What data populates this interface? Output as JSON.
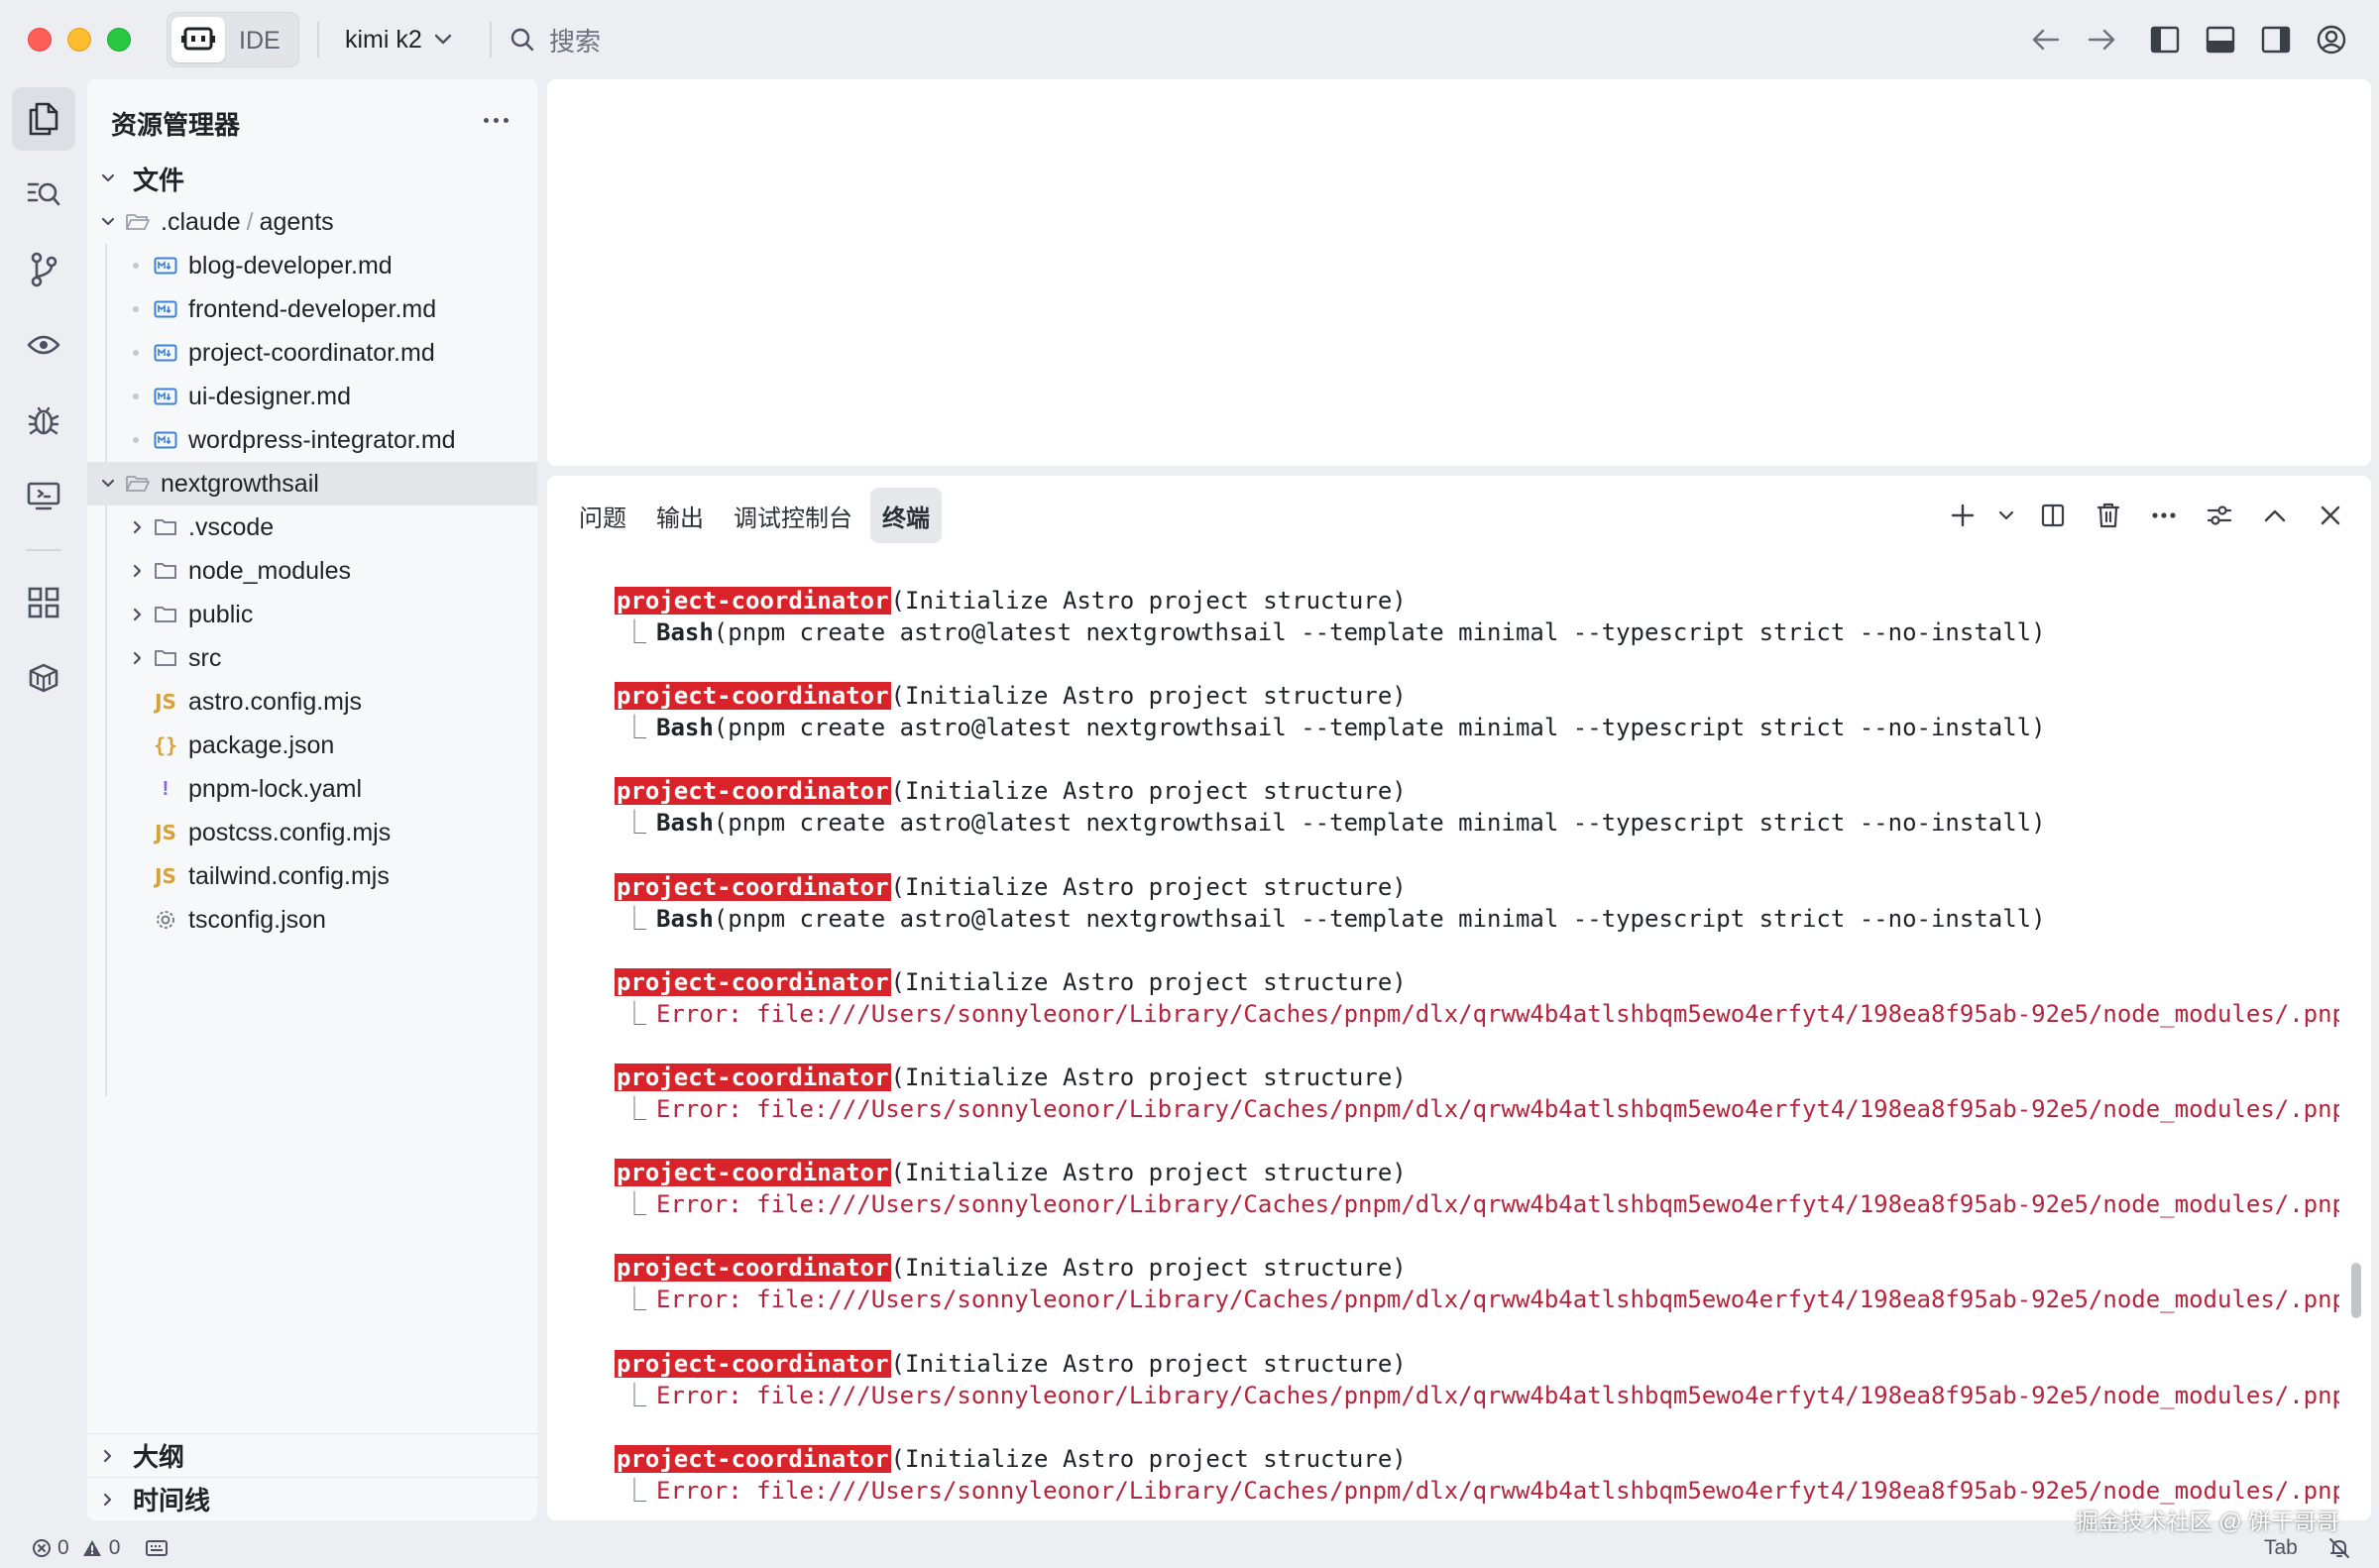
{
  "titlebar": {
    "mode_label": "IDE",
    "model": "kimi k2",
    "search_placeholder": "搜索"
  },
  "explorer": {
    "title": "资源管理器",
    "root_section": "文件",
    "agents_folder_part1": ".claude",
    "agents_folder_sep": "/",
    "agents_folder_part2": "agents",
    "agent_files": [
      "blog-developer.md",
      "frontend-developer.md",
      "project-coordinator.md",
      "ui-designer.md",
      "wordpress-integrator.md"
    ],
    "project_folder": "nextgrowthsail",
    "project_subfolders": [
      ".vscode",
      "node_modules",
      "public",
      "src"
    ],
    "project_files": [
      {
        "name": "astro.config.mjs",
        "icon": "JS"
      },
      {
        "name": "package.json",
        "icon": "{}"
      },
      {
        "name": "pnpm-lock.yaml",
        "icon": "!"
      },
      {
        "name": "postcss.config.mjs",
        "icon": "JS"
      },
      {
        "name": "tailwind.config.mjs",
        "icon": "JS"
      },
      {
        "name": "tsconfig.json",
        "icon": "gear-icon"
      }
    ],
    "outline_label": "大纲",
    "timeline_label": "时间线"
  },
  "panel": {
    "tabs": [
      "问题",
      "输出",
      "调试控制台",
      "终端"
    ],
    "active_tab": "终端"
  },
  "terminal": {
    "entries": [
      {
        "agent": "project-coordinator",
        "task": "(Initialize Astro project structure)",
        "tool": "Bash",
        "detail": "(pnpm create astro@latest nextgrowthsail --template minimal --typescript strict --no-install)",
        "error": false
      },
      {
        "agent": "project-coordinator",
        "task": "(Initialize Astro project structure)",
        "tool": "Bash",
        "detail": "(pnpm create astro@latest nextgrowthsail --template minimal --typescript strict --no-install)",
        "error": false
      },
      {
        "agent": "project-coordinator",
        "task": "(Initialize Astro project structure)",
        "tool": "Bash",
        "detail": "(pnpm create astro@latest nextgrowthsail --template minimal --typescript strict --no-install)",
        "error": false
      },
      {
        "agent": "project-coordinator",
        "task": "(Initialize Astro project structure)",
        "tool": "Bash",
        "detail": "(pnpm create astro@latest nextgrowthsail --template minimal --typescript strict --no-install)",
        "error": false
      },
      {
        "agent": "project-coordinator",
        "task": "(Initialize Astro project structure)",
        "tool": "",
        "detail": "Error: file:///Users/sonnyleonor/Library/Caches/pnpm/dlx/qrww4b4atlshbqm5ewo4erfyt4/198ea8f95ab-92e5/node_modules/.pnpm/@",
        "error": true
      },
      {
        "agent": "project-coordinator",
        "task": "(Initialize Astro project structure)",
        "tool": "",
        "detail": "Error: file:///Users/sonnyleonor/Library/Caches/pnpm/dlx/qrww4b4atlshbqm5ewo4erfyt4/198ea8f95ab-92e5/node_modules/.pnpm/@",
        "error": true
      },
      {
        "agent": "project-coordinator",
        "task": "(Initialize Astro project structure)",
        "tool": "",
        "detail": "Error: file:///Users/sonnyleonor/Library/Caches/pnpm/dlx/qrww4b4atlshbqm5ewo4erfyt4/198ea8f95ab-92e5/node_modules/.pnpm/@",
        "error": true
      },
      {
        "agent": "project-coordinator",
        "task": "(Initialize Astro project structure)",
        "tool": "",
        "detail": "Error: file:///Users/sonnyleonor/Library/Caches/pnpm/dlx/qrww4b4atlshbqm5ewo4erfyt4/198ea8f95ab-92e5/node_modules/.pnpm/@",
        "error": true
      },
      {
        "agent": "project-coordinator",
        "task": "(Initialize Astro project structure)",
        "tool": "",
        "detail": "Error: file:///Users/sonnyleonor/Library/Caches/pnpm/dlx/qrww4b4atlshbqm5ewo4erfyt4/198ea8f95ab-92e5/node_modules/.pnpm/@",
        "error": true
      },
      {
        "agent": "project-coordinator",
        "task": "(Initialize Astro project structure)",
        "tool": "",
        "detail": "Error: file:///Users/sonnyleonor/Library/Caches/pnpm/dlx/qrww4b4atlshbqm5ewo4erfyt4/198ea8f95ab-92e5/node_modules/.pnpm/@",
        "error": true
      }
    ]
  },
  "statusbar": {
    "errors": "0",
    "warnings": "0",
    "tab_label": "Tab",
    "watermark": "掘金技术社区 @ 饼干哥哥"
  },
  "colors": {
    "agent_tag_bg": "#d9232a",
    "error_text": "#b3263e",
    "traffic_red": "#ff5f57",
    "traffic_yellow": "#febc2e",
    "traffic_green": "#28c840"
  }
}
